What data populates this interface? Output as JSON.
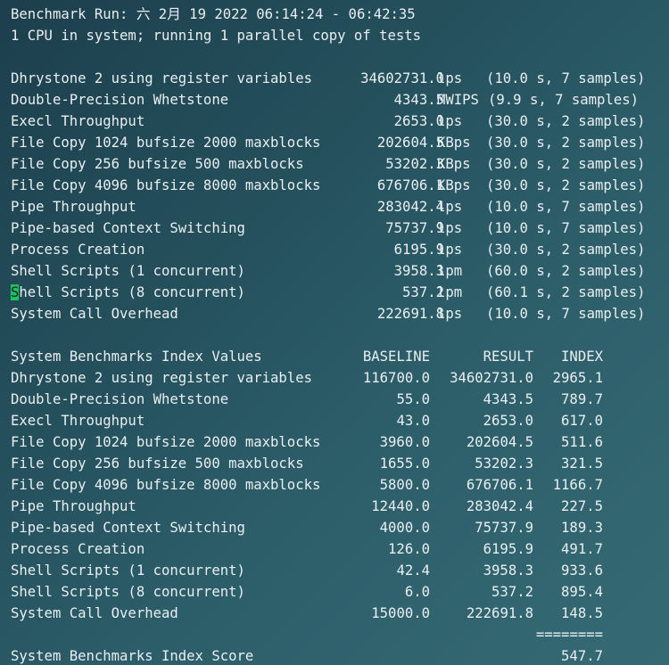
{
  "header": {
    "line1": "Benchmark Run: 六 2月 19 2022 06:14:24 - 06:42:35",
    "line2": "1 CPU in system; running 1 parallel copy of tests"
  },
  "results": [
    {
      "name": "Dhrystone 2 using register variables",
      "value": "34602731.0",
      "unit": "lps",
      "detail": "(10.0 s, 7 samples)"
    },
    {
      "name": "Double-Precision Whetstone",
      "value": "4343.5",
      "unit": "MWIPS",
      "detail": "(9.9 s, 7 samples)"
    },
    {
      "name": "Execl Throughput",
      "value": "2653.0",
      "unit": "lps",
      "detail": "(30.0 s, 2 samples)"
    },
    {
      "name": "File Copy 1024 bufsize 2000 maxblocks",
      "value": "202604.5",
      "unit": "KBps",
      "detail": "(30.0 s, 2 samples)"
    },
    {
      "name": "File Copy 256 bufsize 500 maxblocks",
      "value": "53202.3",
      "unit": "KBps",
      "detail": "(30.0 s, 2 samples)"
    },
    {
      "name": "File Copy 4096 bufsize 8000 maxblocks",
      "value": "676706.1",
      "unit": "KBps",
      "detail": "(30.0 s, 2 samples)"
    },
    {
      "name": "Pipe Throughput",
      "value": "283042.4",
      "unit": "lps",
      "detail": "(10.0 s, 7 samples)"
    },
    {
      "name": "Pipe-based Context Switching",
      "value": "75737.9",
      "unit": "lps",
      "detail": "(10.0 s, 7 samples)"
    },
    {
      "name": "Process Creation",
      "value": "6195.9",
      "unit": "lps",
      "detail": "(30.0 s, 2 samples)"
    },
    {
      "name": "Shell Scripts (1 concurrent)",
      "value": "3958.3",
      "unit": "lpm",
      "detail": "(60.0 s, 2 samples)"
    },
    {
      "name": "Shell Scripts (8 concurrent)",
      "value": "537.2",
      "unit": "lpm",
      "detail": "(60.1 s, 2 samples)"
    },
    {
      "name": "System Call Overhead",
      "value": "222691.8",
      "unit": "lps",
      "detail": "(10.0 s, 7 samples)"
    }
  ],
  "index_header": {
    "title": "System Benchmarks Index Values",
    "baseline": "BASELINE",
    "result": "RESULT",
    "index": "INDEX"
  },
  "index_rows": [
    {
      "name": "Dhrystone 2 using register variables",
      "baseline": "116700.0",
      "result": "34602731.0",
      "index": "2965.1"
    },
    {
      "name": "Double-Precision Whetstone",
      "baseline": "55.0",
      "result": "4343.5",
      "index": "789.7"
    },
    {
      "name": "Execl Throughput",
      "baseline": "43.0",
      "result": "2653.0",
      "index": "617.0"
    },
    {
      "name": "File Copy 1024 bufsize 2000 maxblocks",
      "baseline": "3960.0",
      "result": "202604.5",
      "index": "511.6"
    },
    {
      "name": "File Copy 256 bufsize 500 maxblocks",
      "baseline": "1655.0",
      "result": "53202.3",
      "index": "321.5"
    },
    {
      "name": "File Copy 4096 bufsize 8000 maxblocks",
      "baseline": "5800.0",
      "result": "676706.1",
      "index": "1166.7"
    },
    {
      "name": "Pipe Throughput",
      "baseline": "12440.0",
      "result": "283042.4",
      "index": "227.5"
    },
    {
      "name": "Pipe-based Context Switching",
      "baseline": "4000.0",
      "result": "75737.9",
      "index": "189.3"
    },
    {
      "name": "Process Creation",
      "baseline": "126.0",
      "result": "6195.9",
      "index": "491.7"
    },
    {
      "name": "Shell Scripts (1 concurrent)",
      "baseline": "42.4",
      "result": "3958.3",
      "index": "933.6"
    },
    {
      "name": "Shell Scripts (8 concurrent)",
      "baseline": "6.0",
      "result": "537.2",
      "index": "895.4"
    },
    {
      "name": "System Call Overhead",
      "baseline": "15000.0",
      "result": "222691.8",
      "index": "148.5"
    }
  ],
  "score": {
    "separator": "========",
    "label": "System Benchmarks Index Score",
    "value": "547.7"
  },
  "colors": {
    "cursor": "#20c060"
  }
}
